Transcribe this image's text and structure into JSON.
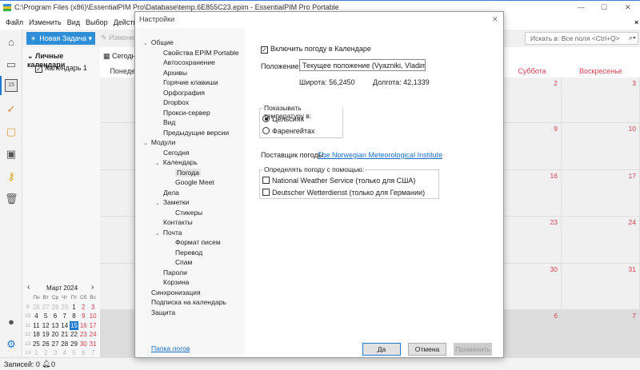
{
  "window": {
    "title": "C:\\Program Files (x86)\\EssentialPIM Pro\\Database\\temp.6E855C23.epim - EssentialPIM Pro Portable",
    "controls": [
      "—",
      "☐",
      "✕"
    ]
  },
  "menu": [
    "Файл",
    "Изменить",
    "Вид",
    "Выбор",
    "Действия"
  ],
  "toolbar": {
    "new_task": "Новая Задача",
    "edit": "Изменить",
    "search_placeholder": "Искать в: Все поля <Ctrl+Q>",
    "close_x": "×"
  },
  "sidebar": {
    "group": "Личные календари",
    "calendar": "Календарь 1",
    "today": "Сегодня"
  },
  "calendar": {
    "days": [
      "Понедельник",
      "Суббота",
      "Воскресенье"
    ],
    "rows": [
      [
        "2",
        "3"
      ],
      [
        "9",
        "10"
      ],
      [
        "16",
        "17"
      ],
      [
        "23",
        "24"
      ],
      [
        "30",
        "31"
      ],
      [
        "6",
        "7"
      ]
    ]
  },
  "mini": {
    "month": "Март  2024",
    "prev": "‹",
    "next": "›",
    "weekdays": [
      "Пн",
      "Вт",
      "Ср",
      "Чт",
      "Пт",
      "Сб",
      "Вс"
    ],
    "weeks": [
      [
        "9",
        "26",
        "27",
        "28",
        "29",
        "1",
        "2",
        "3"
      ],
      [
        "10",
        "4",
        "5",
        "6",
        "7",
        "8",
        "9",
        "10"
      ],
      [
        "11",
        "11",
        "12",
        "13",
        "14",
        "15",
        "16",
        "17"
      ],
      [
        "12",
        "18",
        "19",
        "20",
        "21",
        "22",
        "23",
        "24"
      ],
      [
        "13",
        "25",
        "26",
        "27",
        "28",
        "29",
        "30",
        "31"
      ],
      [
        "14",
        "1",
        "2",
        "3",
        "4",
        "5",
        "6",
        "7"
      ]
    ],
    "selected": "15"
  },
  "status": {
    "records": "Записей: 0",
    "notifications": "0"
  },
  "dialog": {
    "title": "Настройки",
    "close": "✕",
    "tree": [
      {
        "l": "Общие",
        "d": 0,
        "c": true
      },
      {
        "l": "Свойства EPIM Portable",
        "d": 1
      },
      {
        "l": "Автосохранение",
        "d": 1
      },
      {
        "l": "Архивы",
        "d": 1
      },
      {
        "l": "Горячие клавиши",
        "d": 1
      },
      {
        "l": "Орфография",
        "d": 1
      },
      {
        "l": "Dropbox",
        "d": 1
      },
      {
        "l": "Прокси-сервер",
        "d": 1
      },
      {
        "l": "Вид",
        "d": 1
      },
      {
        "l": "Предыдущие версии",
        "d": 1
      },
      {
        "l": "Модули",
        "d": 0,
        "c": true
      },
      {
        "l": "Сегодня",
        "d": 1
      },
      {
        "l": "Календарь",
        "d": 1,
        "c": true
      },
      {
        "l": "Погода",
        "d": 2,
        "sel": true
      },
      {
        "l": "Google Meet",
        "d": 2
      },
      {
        "l": "Дела",
        "d": 1
      },
      {
        "l": "Заметки",
        "d": 1,
        "c": true
      },
      {
        "l": "Стикеры",
        "d": 2
      },
      {
        "l": "Контакты",
        "d": 1
      },
      {
        "l": "Почта",
        "d": 1,
        "c": true
      },
      {
        "l": "Формат писем",
        "d": 2
      },
      {
        "l": "Перевод",
        "d": 2
      },
      {
        "l": "Спам",
        "d": 2
      },
      {
        "l": "Пароли",
        "d": 1
      },
      {
        "l": "Корзина",
        "d": 1
      },
      {
        "l": "Синхронизация",
        "d": 0
      },
      {
        "l": "Подписка на календарь",
        "d": 0
      },
      {
        "l": "Защита",
        "d": 0
      }
    ],
    "log_link": "Папка логов",
    "enable_weather": "Включить погоду в Календаре",
    "location_label": "Положение:",
    "location_value": "Текущее положение (Vyazniki, Vladimir O",
    "latitude": "Широта: 56,2450",
    "longitude": "Долгота: 42,1339",
    "temp_group": "Показывать температуру в:",
    "celsius": "Цельсиях",
    "fahrenheit": "Фаренгейтах",
    "provider_label": "Поставщик погоды:",
    "provider_link": "The Norwegian Meteorological Institute",
    "detect_group": "Определять погоду с помощью:",
    "nws": "National Weather Service (только для США)",
    "dwd": "Deutscher Wetterdienst (только для Германии)",
    "ok": "Да",
    "cancel": "Отмена",
    "apply": "Применить"
  }
}
